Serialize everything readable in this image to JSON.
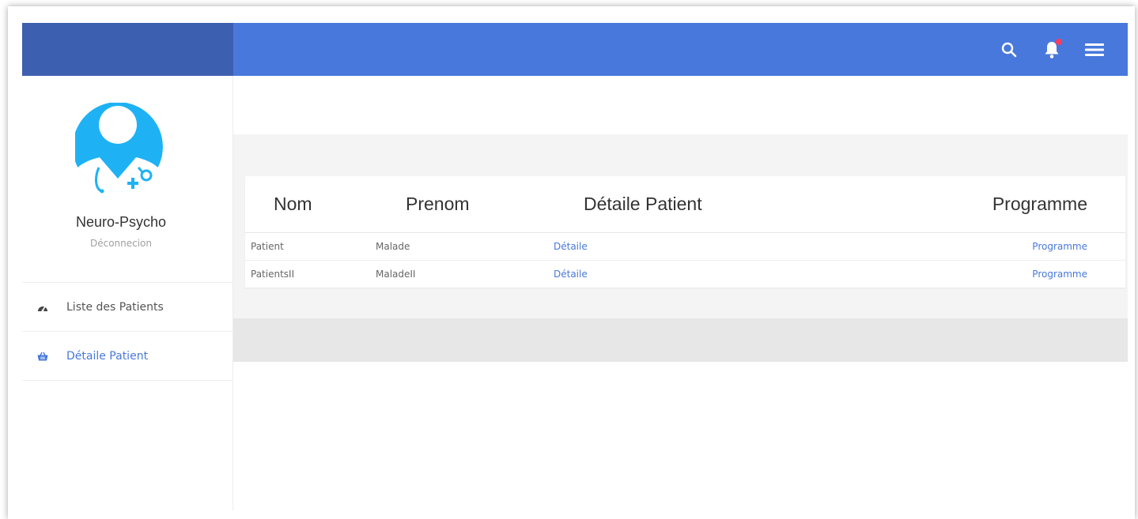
{
  "sidebar": {
    "profile_name": "Neuro-Psycho",
    "logout_label": "Déconnecion",
    "menu": [
      {
        "label": "Liste des Patients",
        "icon": "dashboard-icon"
      },
      {
        "label": "Détaile Patient",
        "icon": "basket-icon"
      }
    ]
  },
  "topbar": {
    "icons": [
      "search-icon",
      "bell-icon",
      "menu-icon"
    ]
  },
  "patients_table": {
    "headers": [
      "Nom",
      "Prenom",
      "Détaile Patient",
      "Programme"
    ],
    "rows": [
      {
        "nom": "Patient",
        "prenom": "Malade",
        "detail": "Détaile",
        "programme": "Programme"
      },
      {
        "nom": "PatientsII",
        "prenom": "MaladeII",
        "detail": "Détaile",
        "programme": "Programme"
      }
    ]
  },
  "colors": {
    "topbar": "#4878db",
    "sidebar_header": "#3d5faf",
    "link": "#4878db",
    "notification_dot": "#ff3b5c",
    "avatar": "#1eb2f5"
  }
}
